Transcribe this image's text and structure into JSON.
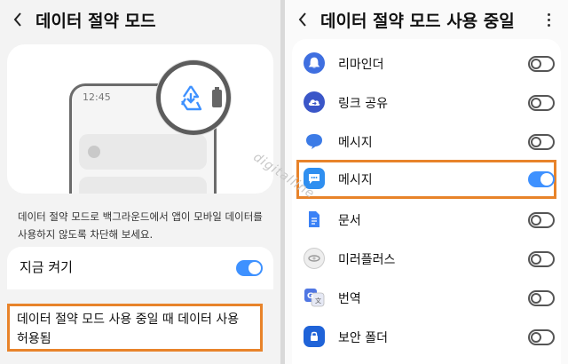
{
  "left": {
    "title": "데이터 절약 모드",
    "illustration_time": "12:45",
    "description": "데이터 절약 모드로 백그라운드에서 앱이 모바일 데이터를 사용하지 않도록 차단해 보세요.",
    "toggle_label": "지금 켜기",
    "toggle_on": true,
    "allowed_link": "데이터 절약 모드 사용 중일 때 데이터 사용 허용됨"
  },
  "right": {
    "title": "데이터 절약 모드 사용 중일",
    "apps": [
      {
        "name": "리마인더",
        "icon": "bell-icon",
        "color": "#3f6fe0",
        "on": false
      },
      {
        "name": "링크 공유",
        "icon": "link-share-cloud-icon",
        "color": "#3a56c8",
        "on": false
      },
      {
        "name": "메시지",
        "icon": "message-bubble-icon",
        "color": "#3c7be6",
        "on": false
      },
      {
        "name": "메시지",
        "icon": "message-dots-icon",
        "color": "#2f8ff0",
        "on": true
      },
      {
        "name": "문서",
        "icon": "document-icon",
        "color": "#3b82f6",
        "on": false
      },
      {
        "name": "미러플러스",
        "icon": "mirror-plus-icon",
        "color": "#e5e5e5",
        "on": false
      },
      {
        "name": "번역",
        "icon": "translate-icon",
        "color": "#4f76e3",
        "on": false
      },
      {
        "name": "보안 폴더",
        "icon": "lock-folder-icon",
        "color": "#1f63d8",
        "on": false
      }
    ]
  },
  "watermark": "digitalline",
  "colors": {
    "accent": "#3e91ff",
    "highlight": "#e8832a"
  }
}
